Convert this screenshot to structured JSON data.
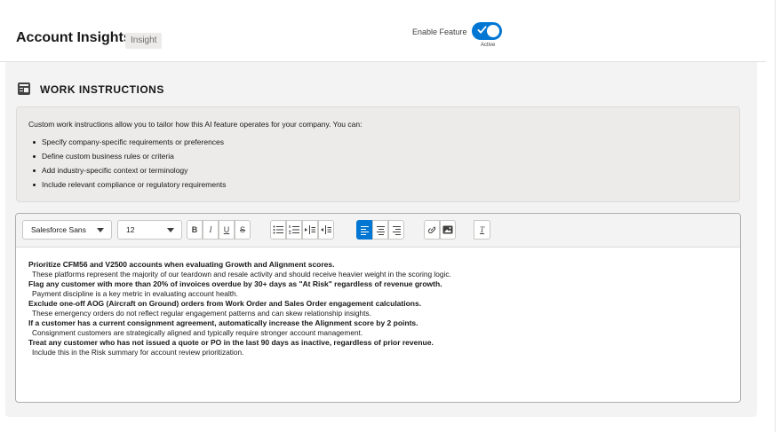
{
  "header": {
    "title": "Account Insights",
    "badge": "Insight",
    "toggle_label": "Enable Feature",
    "toggle_status": "Active",
    "toggle_on": true,
    "accent_color": "#0176d3"
  },
  "section": {
    "icon": "document-list-icon",
    "title": "WORK INSTRUCTIONS"
  },
  "info": {
    "intro": "Custom work instructions allow you to tailor how this AI feature operates for your company. You can:",
    "items": [
      "Specify company-specific requirements or preferences",
      "Define custom business rules or criteria",
      "Add industry-specific context or terminology",
      "Include relevant compliance or regulatory requirements"
    ]
  },
  "toolbar": {
    "font_family": "Salesforce Sans",
    "font_size": "12",
    "bold": "B",
    "italic": "I",
    "underline": "U",
    "strikethrough": "S",
    "clear_format": "T",
    "active_alignment": "left"
  },
  "editor": {
    "rules": [
      {
        "title": "Prioritize CFM56 and V2500 accounts when evaluating Growth and Alignment scores.",
        "detail": "These platforms represent the majority of our teardown and resale activity and should receive heavier weight in the scoring logic."
      },
      {
        "title": "Flag any customer with more than 20% of invoices overdue by 30+ days as \"At Risk\" regardless of revenue growth.",
        "detail": "Payment discipline is a key metric in evaluating account health."
      },
      {
        "title": "Exclude one-off AOG (Aircraft on Ground) orders from Work Order and Sales Order engagement calculations.",
        "detail": "These emergency orders do not reflect regular engagement patterns and can skew relationship insights."
      },
      {
        "title": "If a customer has a current consignment agreement, automatically increase the Alignment score by 2 points.",
        "detail": "Consignment customers are strategically aligned and typically require stronger account management."
      },
      {
        "title": "Treat any customer who has not issued a quote or PO in the last 90 days as inactive, regardless of prior revenue.",
        "detail": "Include this in the Risk summary for account review prioritization."
      }
    ]
  }
}
